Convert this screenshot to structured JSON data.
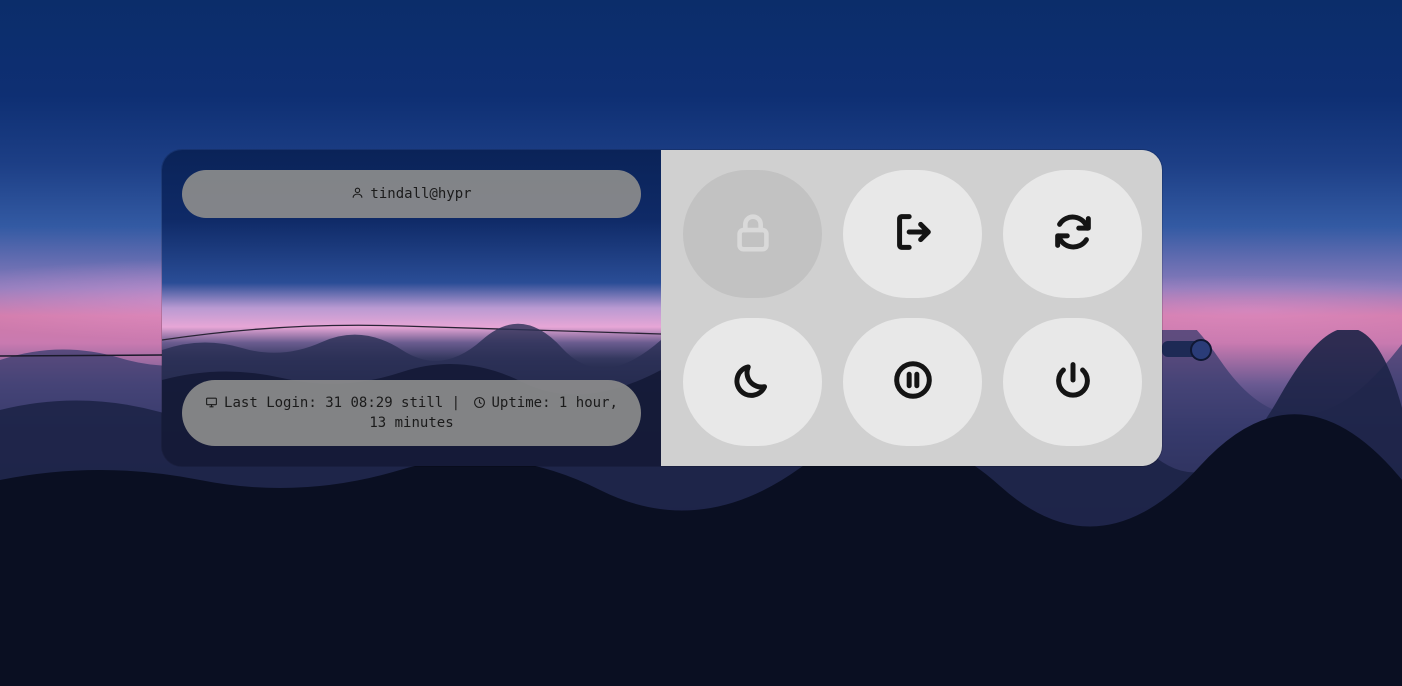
{
  "user": {
    "label": "tindall@hypr",
    "icon": "user-icon"
  },
  "session_info": {
    "last_login_label": "Last Login: 31 08:29 still |",
    "uptime_label": "Uptime: 1 hour, 13 minutes",
    "monitor_icon": "monitor-icon",
    "clock_icon": "clock-icon"
  },
  "actions": [
    {
      "name": "lock",
      "icon": "lock-icon",
      "state": "disabled"
    },
    {
      "name": "logout",
      "icon": "logout-icon",
      "state": "enabled"
    },
    {
      "name": "reboot",
      "icon": "reboot-icon",
      "state": "enabled"
    },
    {
      "name": "sleep",
      "icon": "moon-icon",
      "state": "enabled"
    },
    {
      "name": "suspend",
      "icon": "pause-icon",
      "state": "enabled"
    },
    {
      "name": "shutdown",
      "icon": "power-icon",
      "state": "enabled"
    }
  ],
  "colors": {
    "panel_right": "#d0d0d0",
    "button": "#e8e8e8",
    "button_disabled": "#c2c2c2",
    "pill": "#8c8c8c",
    "icon": "#141414"
  }
}
